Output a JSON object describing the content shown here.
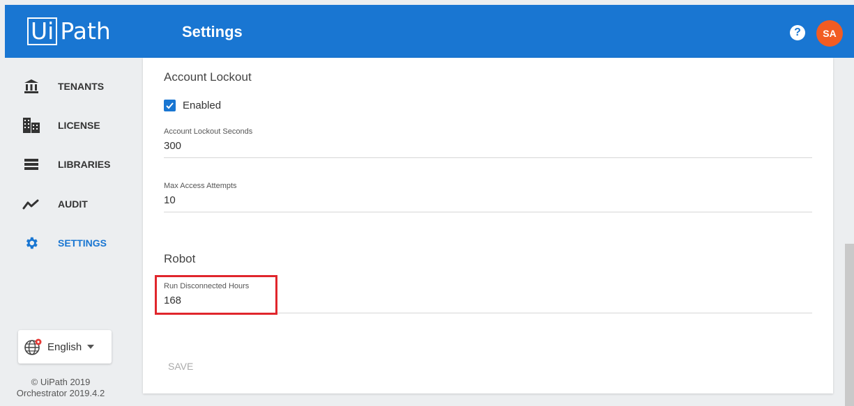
{
  "header": {
    "logo_boxed": "Ui",
    "logo_rest": "Path",
    "title": "Settings",
    "help_icon": "?",
    "avatar_initials": "SA",
    "brand_color": "#1976d2",
    "avatar_color": "#f25c22"
  },
  "sidebar": {
    "items": [
      {
        "label": "TENANTS",
        "icon": "bank-icon",
        "active": false
      },
      {
        "label": "LICENSE",
        "icon": "building-icon",
        "active": false
      },
      {
        "label": "LIBRARIES",
        "icon": "list-icon",
        "active": false
      },
      {
        "label": "AUDIT",
        "icon": "trend-line-icon",
        "active": false
      },
      {
        "label": "SETTINGS",
        "icon": "gear-icon",
        "active": true
      }
    ],
    "language": "English",
    "footer_copyright": "© UiPath 2019",
    "footer_version": "Orchestrator 2019.4.2"
  },
  "main": {
    "account_lockout": {
      "title": "Account Lockout",
      "enabled_label": "Enabled",
      "enabled": true,
      "lockout_seconds_label": "Account Lockout Seconds",
      "lockout_seconds_value": "300",
      "max_attempts_label": "Max Access Attempts",
      "max_attempts_value": "10"
    },
    "robot": {
      "title": "Robot",
      "disconnected_hours_label": "Run Disconnected Hours",
      "disconnected_hours_value": "168"
    },
    "save_label": "SAVE"
  }
}
